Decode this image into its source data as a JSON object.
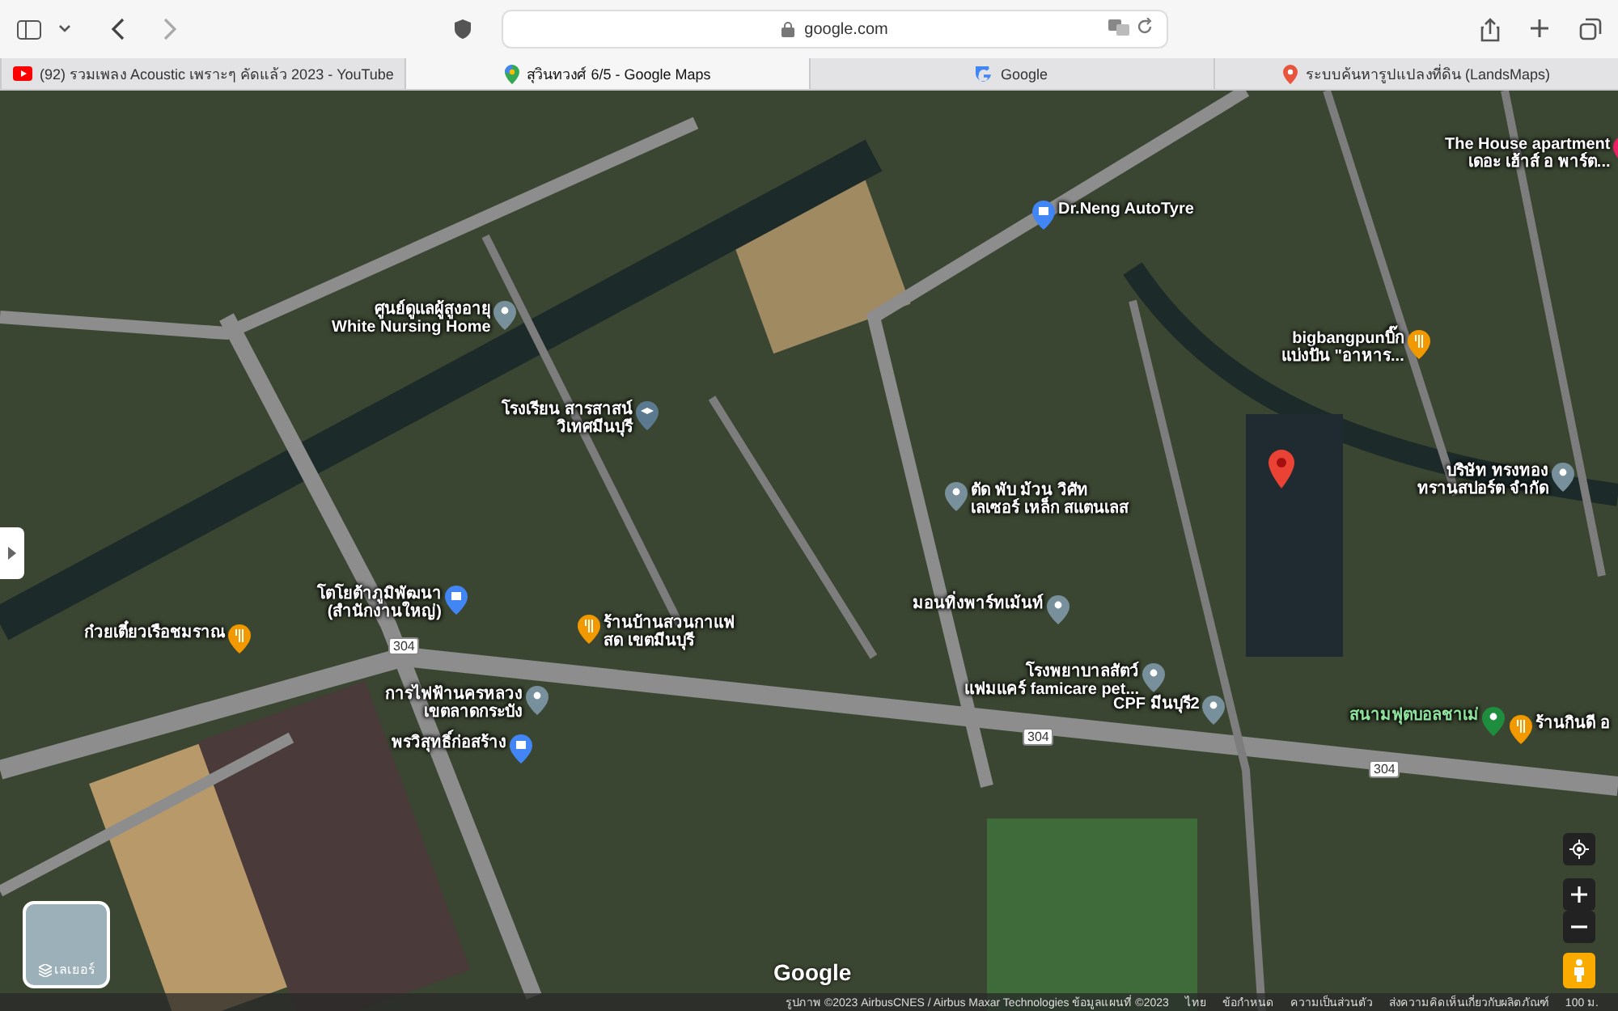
{
  "browser": {
    "address": "google.com"
  },
  "tabs": [
    {
      "label": "(92) รวมเพลง Acoustic เพราะๆ คัดแล้ว 2023 - YouTube",
      "kind": "youtube",
      "selected": false
    },
    {
      "label": "สุวินทวงศ์ 6/5 - Google Maps",
      "kind": "maps",
      "selected": true
    },
    {
      "label": "Google",
      "kind": "google",
      "selected": false
    },
    {
      "label": "ระบบค้นหารูปแปลงที่ดิน (LandsMaps)",
      "kind": "pin",
      "selected": false
    }
  ],
  "map": {
    "places": [
      {
        "lines": [
          "ศูนย์ดูแลผู้สูงอายุ",
          "White Nursing Home"
        ],
        "kind": "place"
      },
      {
        "lines": [
          "Dr.Neng AutoTyre"
        ],
        "kind": "shop"
      },
      {
        "lines": [
          "The House apartment",
          "เดอะ เฮ้าส์ อ พาร์ต..."
        ],
        "kind": "hotel"
      },
      {
        "lines": [
          "bigbangpunบิ๊ก",
          "แบ่งปัน \"อาหาร..."
        ],
        "kind": "food"
      },
      {
        "lines": [
          "โรงเรียน สารสาสน์",
          "วิเทศมีนบุรี"
        ],
        "kind": "school"
      },
      {
        "lines": [
          "โตโยต้าภูมิพัฒนา",
          "(สำนักงานใหญ่)"
        ],
        "kind": "shop"
      },
      {
        "lines": [
          "ก๋วยเตี๋ยวเรือชมราณ"
        ],
        "kind": "food"
      },
      {
        "lines": [
          "ร้านบ้านสวนกาแฟ",
          "สด เขตมีนบุรี"
        ],
        "kind": "food"
      },
      {
        "lines": [
          "การไฟฟ้านครหลวง",
          "เขตลาดกระบัง"
        ],
        "kind": "place"
      },
      {
        "lines": [
          "พรวิสุทธิ์ก่อสร้าง"
        ],
        "kind": "shop"
      },
      {
        "lines": [
          "ตัด พับ ม้วน วิศัท",
          "เลเซอร์ เหล็ก สแตนเลส"
        ],
        "kind": "place"
      },
      {
        "lines": [
          "มอนทิ่งพาร์ทเม้นท์"
        ],
        "kind": "place"
      },
      {
        "lines": [
          "โรงพยาบาลสัตว์",
          "แฟมแคร์ famicare pet..."
        ],
        "kind": "place"
      },
      {
        "lines": [
          "CPF มีนบุรี2"
        ],
        "kind": "place"
      },
      {
        "lines": [
          "บริษัท ทรงทอง",
          "ทรานสปอร์ต จำกัด"
        ],
        "kind": "place"
      },
      {
        "lines": [
          "สนามฟุตบอลชาเม่"
        ],
        "kind": "park"
      },
      {
        "lines": [
          "ร้านกินดี อ"
        ],
        "kind": "food"
      }
    ],
    "shields": [
      "304",
      "304",
      "304"
    ],
    "layers_label": "เลเยอร์",
    "logo": "Google",
    "footer": [
      "รูปภาพ ©2023 AirbusCNES / Airbus Maxar Technologies ข้อมูลแผนที่ ©2023",
      "ไทย",
      "ข้อกำหนด",
      "ความเป็นส่วนตัว",
      "ส่งความคิดเห็นเกี่ยวกับผลิตภัณฑ์",
      "100 ม."
    ]
  }
}
